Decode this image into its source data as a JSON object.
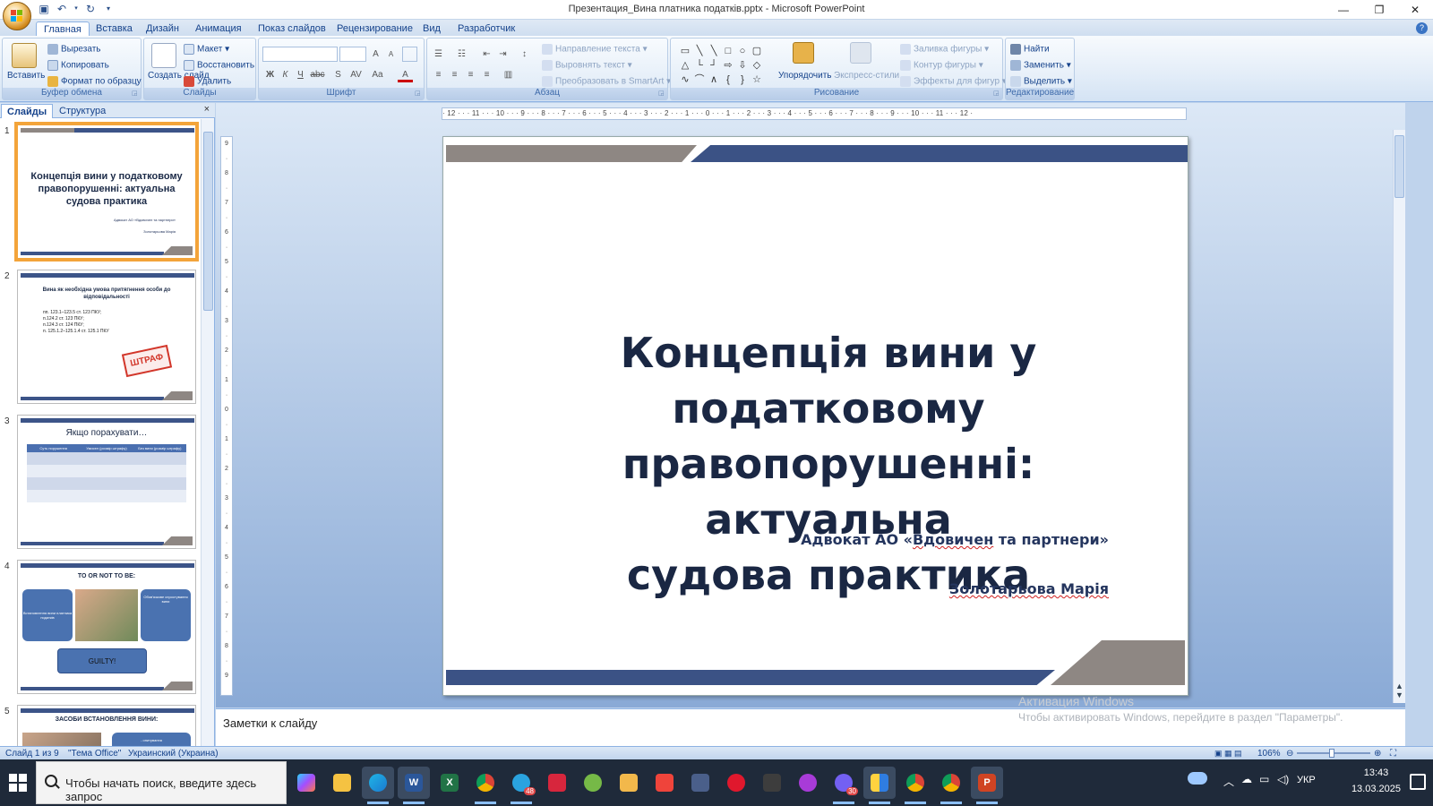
{
  "window": {
    "title": "Презентация_Вина платника податків.pptx - Microsoft PowerPoint",
    "controls": [
      "—",
      "❐",
      "✕"
    ]
  },
  "ribbon": {
    "tabs": [
      "Главная",
      "Вставка",
      "Дизайн",
      "Анимация",
      "Показ слайдов",
      "Рецензирование",
      "Вид",
      "Разработчик"
    ],
    "active_tab": "Главная",
    "clipboard": {
      "label": "Буфер обмена",
      "paste": "Вставить",
      "cut": "Вырезать",
      "copy": "Копировать",
      "format_painter": "Формат по образцу"
    },
    "slides": {
      "label": "Слайды",
      "new_slide": "Создать слайд",
      "layout": "Макет",
      "reset": "Восстановить",
      "delete": "Удалить"
    },
    "font": {
      "label": "Шрифт",
      "bold": "Ж",
      "italic": "К",
      "underline": "Ч",
      "strike": "abc",
      "shadow": "S",
      "spacing": "AV",
      "case": "Aa",
      "color": "A",
      "grow": "A",
      "shrink": "A",
      "clear": ""
    },
    "paragraph": {
      "label": "Абзац",
      "text_direction": "Направление текста",
      "align_text": "Выровнять текст",
      "smartart": "Преобразовать в SmartArt"
    },
    "drawing": {
      "label": "Рисование",
      "arrange": "Упорядочить",
      "quick_styles": "Экспресс-стили",
      "shape_fill": "Заливка фигуры",
      "shape_outline": "Контур фигуры",
      "shape_effects": "Эффекты для фигур"
    },
    "editing": {
      "label": "Редактирование",
      "find": "Найти",
      "replace": "Заменить",
      "select": "Выделить"
    }
  },
  "slides_pane": {
    "tabs": [
      "Слайды",
      "Структура"
    ],
    "close": "×",
    "thumbnails": [
      {
        "num": "1",
        "title": "Концепція вини у податковому правопорушенні: актуальна судова практика",
        "sub1": "Адвокат АО «Вдовичен та партнери»",
        "sub2": "Золотарьова Марія"
      },
      {
        "num": "2",
        "title": "Вина як необхідна умова притягнення особи до відповідальності",
        "lines": [
          "пп. 123.1–123.5 ст. 123 ПКУ;",
          "п.124.2 ст. 123 ПКУ;",
          "п.124.3 ст. 124 ПКУ;",
          "п. 125.1.2–125.1.4 ст. 125.1 ПКУ"
        ],
        "stamp": "ШТРАФ"
      },
      {
        "num": "3",
        "title": "Якщо порахувати…",
        "headers": [
          "Суть порушення",
          "Умисел (розмір штрафу)",
          "Без вини (розмір штрафу)"
        ]
      },
      {
        "num": "4",
        "title": "TO OR NOT TO BE:",
        "left_box": "Встановлення вини платника податків",
        "right_box": "Обов'язкове спростування вини",
        "button": "GUILTY!"
      },
      {
        "num": "5",
        "title": "ЗАСОБИ ВСТАНОВЛЕННЯ ВИНИ:",
        "right_box": "- опитування"
      }
    ]
  },
  "slide": {
    "title_lines": [
      "Концепція вини у податковому",
      "правопорушенні: актуальна",
      "судова практика"
    ],
    "subtitle_prefix": "Адвокат АО «",
    "subtitle_company": "Вдовичен",
    "subtitle_suffix": " та партнери»",
    "author": "Золотарьова Марія"
  },
  "ruler": {
    "horizontal": "· 12 · · · 11 · · · 10 · · · 9 · · · 8 · · · 7 · · · 6 · · · 5 · · · 4 · · · 3 · · · 2 · · · 1 · · · 0 · · · 1 · · · 2 · · · 3 · · · 4 · · · 5 · · · 6 · · · 7 · · · 8 · · · 9 · · · 10 · · · 11 · · · 12 ·",
    "vertical": [
      "9",
      "·",
      "8",
      "·",
      "7",
      "·",
      "6",
      "·",
      "5",
      "·",
      "4",
      "·",
      "3",
      "·",
      "2",
      "·",
      "1",
      "·",
      "0",
      "·",
      "1",
      "·",
      "2",
      "·",
      "3",
      "·",
      "4",
      "·",
      "5",
      "·",
      "6",
      "·",
      "7",
      "·",
      "8",
      "·",
      "9"
    ]
  },
  "notes": {
    "placeholder": "Заметки к слайду"
  },
  "activation": {
    "title": "Активация Windows",
    "text": "Чтобы активировать Windows, перейдите в раздел \"Параметры\"."
  },
  "statusbar": {
    "slide_info": "Слайд 1 из 9",
    "theme": "\"Тема Office\"",
    "language": "Украинский (Украина)",
    "zoom": "106%"
  },
  "taskbar": {
    "search_placeholder": "Чтобы начать поиск, введите здесь запрос",
    "lang": "УКР",
    "time": "13:43",
    "date": "13.03.2025",
    "badge_telegram": "48",
    "badge_viber": "30"
  },
  "colors": {
    "slide_blue": "#3b5285",
    "slide_gray": "#8e8783",
    "title_color": "#1a2743",
    "selection": "#f3a43a"
  }
}
